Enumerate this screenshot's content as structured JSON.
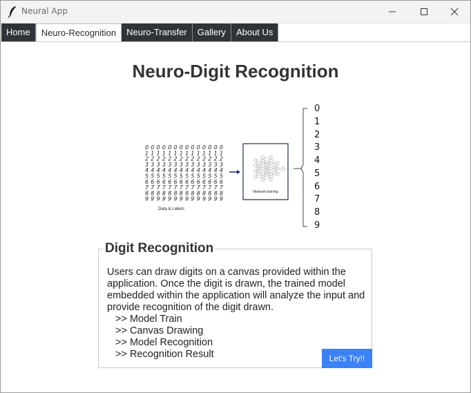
{
  "window": {
    "title": "Neural App",
    "icon": "feather-icon"
  },
  "controls": [
    "minimize-icon",
    "maximize-icon",
    "close-icon"
  ],
  "tabs": [
    {
      "label": "Home",
      "active": false
    },
    {
      "label": "Neuro-Recognition",
      "active": true
    },
    {
      "label": "Neuro-Transfer",
      "active": false
    },
    {
      "label": "Gallery",
      "active": false
    },
    {
      "label": "About Us",
      "active": false
    }
  ],
  "main": {
    "title": "Neuro-Digit Recognition",
    "diagram": {
      "data_caption": "Data & Labels",
      "network_caption": "Network training",
      "outputs": [
        "0",
        "1",
        "2",
        "3",
        "4",
        "5",
        "6",
        "7",
        "8",
        "9"
      ]
    },
    "section": {
      "legend": "Digit Recognition",
      "description": "Users can draw digits on a canvas provided within the application. Once the digit is drawn, the trained model embedded within the application will analyze the input and provide recognition of the digit drawn.",
      "steps": [
        ">> Model Train",
        ">> Canvas Drawing",
        ">> Model Recognition",
        ">> Recognition Result"
      ],
      "button_label": "Let's Try!!"
    }
  },
  "colors": {
    "tab_dark": "#2f3438",
    "accent_button": "#3b82f6",
    "network_border": "#1f2a6b"
  }
}
